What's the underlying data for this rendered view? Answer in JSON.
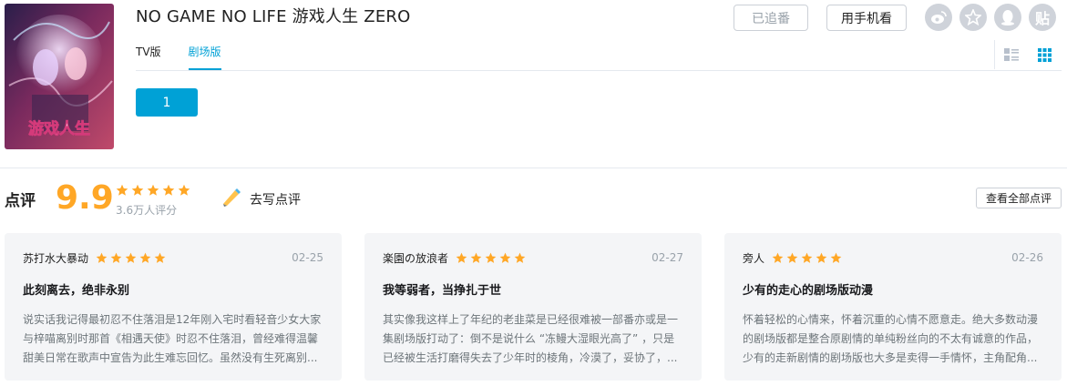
{
  "anime": {
    "title": "NO GAME NO LIFE 游戏人生 ZERO",
    "cover_text": "游戏人生"
  },
  "actions": {
    "followed_label": "已追番",
    "phone_label": "用手机看"
  },
  "share_icons": [
    "weibo-icon",
    "qzone-icon",
    "qq-icon",
    "tieba-icon"
  ],
  "share_tieba_glyph": "贴",
  "tabs": [
    {
      "label": "TV版",
      "active": false
    },
    {
      "label": "剧场版",
      "active": true
    }
  ],
  "view_modes": [
    "list-view-icon",
    "grid-view-icon"
  ],
  "episodes": [
    {
      "label": "1"
    }
  ],
  "review_summary": {
    "heading": "点评",
    "score": "9.9",
    "stars": 5,
    "count": "3.6万人评分",
    "write_label": "去写点评",
    "all_label": "查看全部点评"
  },
  "reviews": [
    {
      "author": "苏打水大暴动",
      "stars": 5,
      "date": "02-25",
      "title": "此刻离去，绝非永别",
      "body": "说实话我记得最初忍不住落泪是12年刚入宅时看轻音少女大家与梓喵离别时那首《相遇天使》时忍不住落泪，曾经难得温馨甜美日常在歌声中宣告为此生难忘回忆。虽然没有生死离别..."
    },
    {
      "author": "楽園の放浪者",
      "stars": 5,
      "date": "02-27",
      "title": "我等弱者，当挣扎于世",
      "body": "其实像我这样上了年纪的老韭菜是已经很难被一部番亦或是一集剧场版打动了：倒不是说什么 “冻鳗大湿眼光高了” ，只是已经被生活打磨得失去了少年时的棱角，冷漠了，妥协了，..."
    },
    {
      "author": "旁人",
      "stars": 5,
      "date": "02-26",
      "title": "少有的走心的剧场版动漫",
      "body": "怀着轻松的心情来，怀着沉重的心情不愿意走。绝大多数动漫的剧场版都是整合原剧情的单纯粉丝向的不太有诚意的作品，少有的走新剧情的剧场版也大多是卖得一手情怀，主角配角..."
    }
  ],
  "colors": {
    "accent": "#00a1d6",
    "score": "#ffa726",
    "card_bg": "#f4f5f7"
  }
}
